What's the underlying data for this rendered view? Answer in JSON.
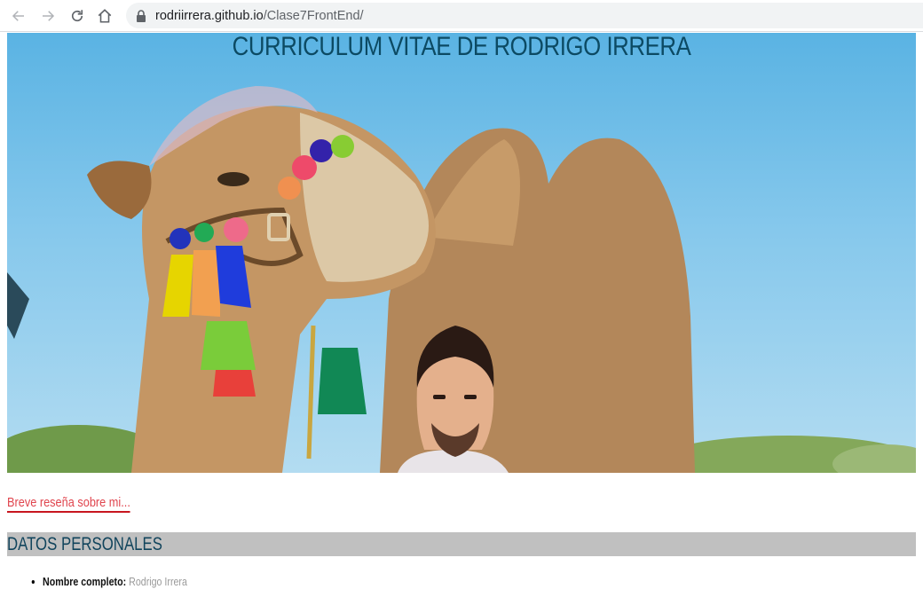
{
  "browser": {
    "url_domain": "rodriirrera.github.io",
    "url_path": "/Clase7FrontEnd/"
  },
  "page": {
    "title": "CURRICULUM VITAE DE RODRIGO IRRERA",
    "bio_link": "Breve reseña sobre mi...",
    "section_heading": "DATOS PERSONALES",
    "personal_data": [
      {
        "label": "Nombre completo:",
        "value": "Rodrigo Irrera"
      }
    ]
  },
  "colors": {
    "title": "#0c4a63",
    "link": "#e0454e",
    "section_bg": "#c0c0c0"
  }
}
